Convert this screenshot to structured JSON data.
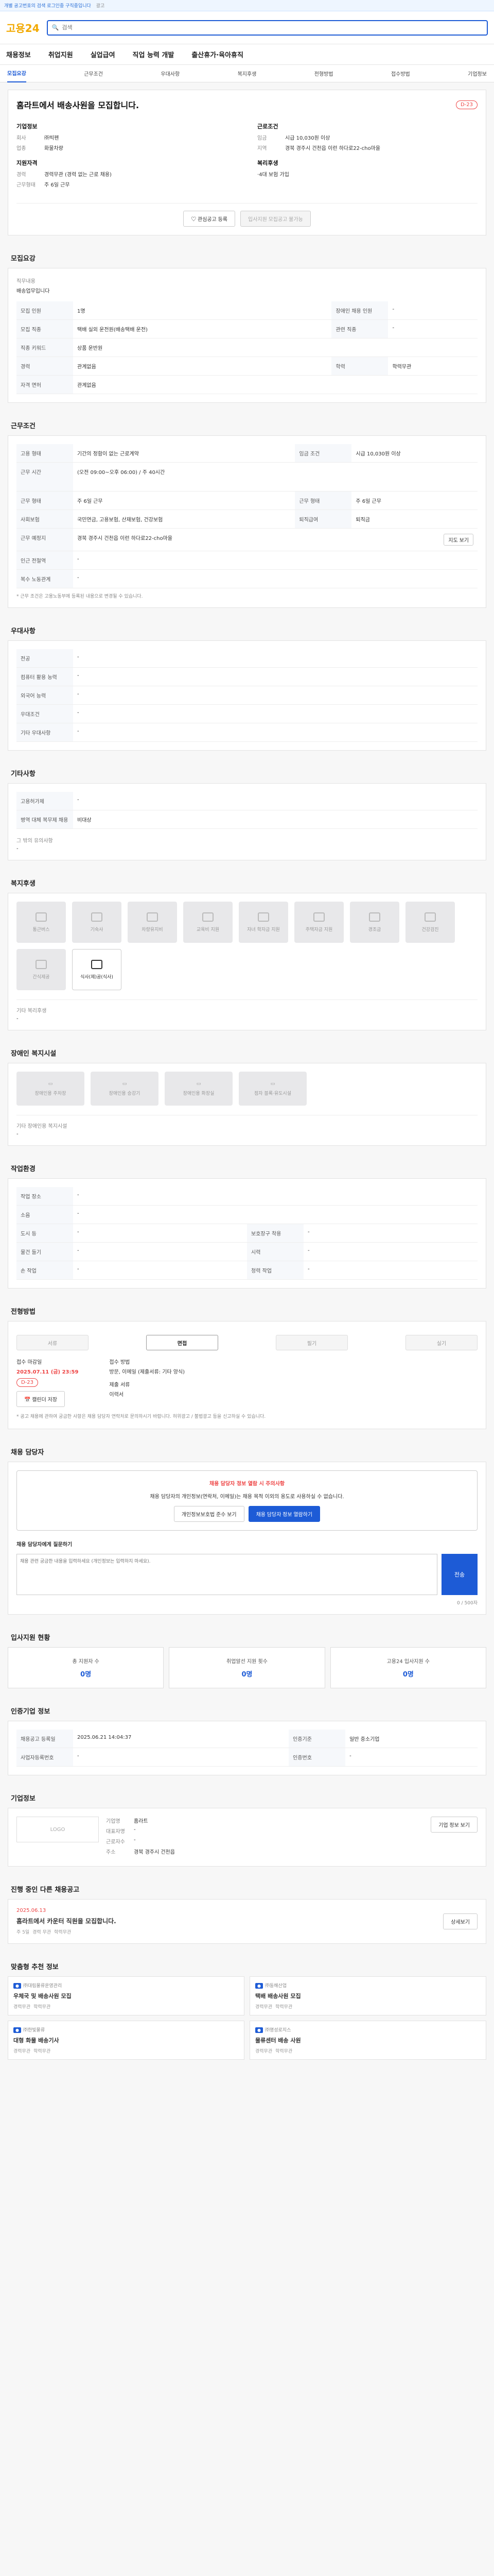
{
  "topbar": {
    "notice": "개별 공고번호의 검색 로그인중 구직중입니다",
    "ad": "광고"
  },
  "header": {
    "logo_main": "고용24",
    "search_placeholder": "검색",
    "nav": [
      "채용정보",
      "취업지원",
      "실업급여",
      "직업 능력 개발",
      "출산휴가·육아휴직"
    ]
  },
  "tabs": [
    "모집요강",
    "근무조건",
    "우대사항",
    "복지후생",
    "전형방법",
    "접수방법",
    "기업정보"
  ],
  "job": {
    "title": "홈라트에서 배송사원을 모집합니다.",
    "dday": "D-23",
    "company_h": "기업정보",
    "condition_h": "근로조건",
    "req_h": "지원자격",
    "misc_h": "복리후생",
    "company": [
      {
        "k": "회사",
        "v": "㈜빅펜"
      },
      {
        "k": "업종",
        "v": "화물차량"
      }
    ],
    "condition": [
      {
        "k": "임금",
        "v": "시급 10,030원 이상"
      },
      {
        "k": "지역",
        "v": "경북 경주시 건천읍 이런 하다로22-cho마을"
      }
    ],
    "req": [
      {
        "k": "경력",
        "v": "경력무관 (경력 없는 근로 채용)"
      },
      {
        "k": "근무형태",
        "v": "주 6일 근무"
      }
    ],
    "misc": "·4대 보험 가입",
    "btn_save": "관심공고 등록",
    "btn_apply": "입사지원 모집공고 불가능"
  },
  "recruit": {
    "h": "모집요강",
    "jobname_k": "직무내용",
    "jobname_v": "배송업무입니다",
    "rows": [
      {
        "k": "모집 인원",
        "v": "1명",
        "k2": "장애인 채용 인원",
        "v2": "-"
      },
      {
        "k": "모집 직종",
        "v": "택배 실외 운전원(배송택배 운전)",
        "k2": "관련 직종",
        "v2": "-"
      },
      {
        "k": "직종 키워드",
        "v": "상품 운반원",
        "k2": "",
        "v2": ""
      },
      {
        "k": "경력",
        "v": "관계없음",
        "k2": "학력",
        "v2": "학력무관"
      },
      {
        "k": "자격 면허",
        "v": "관계없음",
        "k2": "",
        "v2": ""
      }
    ]
  },
  "work": {
    "h": "근무조건",
    "rows": [
      {
        "k": "고용 형태",
        "v": "기간의 정함이 없는 근로계약",
        "k2": "임금 조건",
        "v2": "시급 10,030원 이상"
      },
      {
        "k": "근무 시간",
        "v": "(오전 09:00~오후 06:00) / 주 40시간",
        "k2": "",
        "v2": ""
      },
      {
        "k": "근무 형태",
        "v": "주 6일 근무",
        "k2": "근무 형태",
        "v2": "주 6일 근무"
      },
      {
        "k": "사회보험",
        "v": "국민연금, 고용보험, 산재보험, 건강보험",
        "k2": "퇴직급여",
        "v2": "퇴직금"
      },
      {
        "k": "근무 예정지",
        "v": "경북 경주시 건천읍 이런 하다로22-cho마을",
        "k2": "",
        "v2": ""
      },
      {
        "k": "인근 전철역",
        "v": "-",
        "k2": "",
        "v2": ""
      },
      {
        "k": "복수 노동관계",
        "v": "-",
        "k2": "",
        "v2": ""
      }
    ],
    "map_btn": "지도 보기",
    "note": "* 근무 조건은 고용노동부에 등록된 내용으로 변경될 수 있습니다."
  },
  "prefer": {
    "h": "우대사항",
    "rows": [
      {
        "k": "전공",
        "v": "-"
      },
      {
        "k": "컴퓨터 활용 능력",
        "v": "-"
      },
      {
        "k": "외국어 능력",
        "v": "-"
      },
      {
        "k": "우대조건",
        "v": "-"
      },
      {
        "k": "기타 우대사항",
        "v": "-"
      }
    ]
  },
  "etc": {
    "h": "기타사항",
    "rows": [
      {
        "k": "고용허가제",
        "v": "-"
      },
      {
        "k": "병역 대체 복무제 채용",
        "v": "비대상"
      }
    ],
    "extra_k": "그 밖의 유의사항",
    "extra_v": "-"
  },
  "welfare": {
    "h": "복지후생",
    "items": [
      "통근버스",
      "기숙사",
      "차량유지비",
      "교육비 지원",
      "자녀 학자금 지원",
      "주택자금 지원",
      "경조금",
      "건강검진",
      "간식제공",
      "식사(제)공(식사)"
    ],
    "extra_k": "기타 복리후생",
    "extra_v": "-"
  },
  "disabled": {
    "h": "장애인 복지시설",
    "items": [
      "장애인용 주차장",
      "장애인용 승강기",
      "장애인용 화장실",
      "점자 블록·유도시설"
    ],
    "extra_k": "기타 장애인용 복지시설",
    "extra_v": "-"
  },
  "env": {
    "h": "작업환경",
    "rows": [
      {
        "k": "작업 장소",
        "v": "-",
        "k2": "",
        "v2": ""
      },
      {
        "k": "소음",
        "v": "-",
        "k2": "",
        "v2": ""
      },
      {
        "k": "도시 등",
        "v": "-",
        "k2": "보호장구 착용",
        "v2": "-"
      },
      {
        "k": "물건 들기",
        "v": "-",
        "k2": "시력",
        "v2": "-"
      },
      {
        "k": "손 작업",
        "v": "-",
        "k2": "청력 작업",
        "v2": "-"
      }
    ]
  },
  "process": {
    "h": "전형방법",
    "steps": [
      "서류",
      "면접",
      "필기",
      "실기"
    ],
    "period_k": "접수 마감일",
    "period_v": "2025.07.11 (금) 23:59",
    "dday": "D-23",
    "btn_cal": "캘린더 저장",
    "method_k": "접수 방법",
    "method_v": "방문, 이메일 (제출서류: 기타 양식)",
    "docs_k": "제출 서류",
    "docs_v": "이력서",
    "notice": "* 공고 채용에 관하여 궁금한 사항은 채용 담당자 연락처로 문의하시기 바랍니다. 허위광고 / 불법광고 등을 신고하실 수 있습니다."
  },
  "contact": {
    "h": "채용 담당자",
    "warn": "채용 담당자 정보 열람 시 주의사항",
    "msg": "채용 담당자의 개인정보(연락처, 이메일)는 채용 목적 이외의 용도로 사용하실 수 없습니다.",
    "btn1": "개인정보보호법 준수 보기",
    "btn2": "채용 담당자 정보 열람하기",
    "q_h": "채용 담당자에게 질문하기",
    "q_placeholder": "채용 관련 궁금한 내용을 입력하세요 (개인정보는 입력하지 마세요).",
    "q_send": "전송",
    "q_count": "0 / 500자"
  },
  "status": {
    "h": "입사지원 현황",
    "items": [
      {
        "label": "총 지원자 수",
        "val": "0명"
      },
      {
        "label": "취업알선 지원 횟수",
        "val": "0명"
      },
      {
        "label": "고용24 입사지원 수",
        "val": "0명"
      }
    ]
  },
  "reginfo": {
    "h": "인증기업 정보",
    "rows": [
      {
        "k": "채용공고 등록일",
        "v": "2025.06.21 14:04:37",
        "k2": "인증기준",
        "v2": "일반 중소기업"
      },
      {
        "k": "사업자등록번호",
        "v": "-",
        "k2": "인증번호",
        "v2": "-"
      }
    ]
  },
  "company": {
    "h": "기업정보",
    "logo": "LOGO",
    "name_k": "기업명",
    "name_v": "홈라트",
    "ceo_k": "대표자명",
    "ceo_v": "-",
    "emp_k": "근로자수",
    "emp_v": "-",
    "addr_k": "주소",
    "addr_v": "경북 경주시 건천읍",
    "btn_more": "기업 정보 보기"
  },
  "similar": {
    "h": "진행 중인 다른 채용공고",
    "date": "2025.06.13",
    "title": "홈라트에서 카운터 직원을 모집합니다.",
    "meta": [
      "주 5일",
      "경력 무관",
      "학력무관"
    ],
    "btn": "상세보기"
  },
  "recommend": {
    "h": "맞춤형 추천 정보",
    "items": [
      {
        "co": "㈜대림물류운영관리",
        "t": "우체국 및 배송사원 모집",
        "tags": [
          "경력무관",
          "학력무관"
        ]
      },
      {
        "co": "㈜동해산업",
        "t": "택배 배송사원 모집",
        "tags": [
          "경력무관",
          "학력무관"
        ]
      },
      {
        "co": "㈜한빛물류",
        "t": "대형 화물 배송기사",
        "tags": [
          "경력무관",
          "학력무관"
        ]
      },
      {
        "co": "㈜명성로지스",
        "t": "물류센터 배송 사원",
        "tags": [
          "경력무관",
          "학력무관"
        ]
      }
    ]
  }
}
